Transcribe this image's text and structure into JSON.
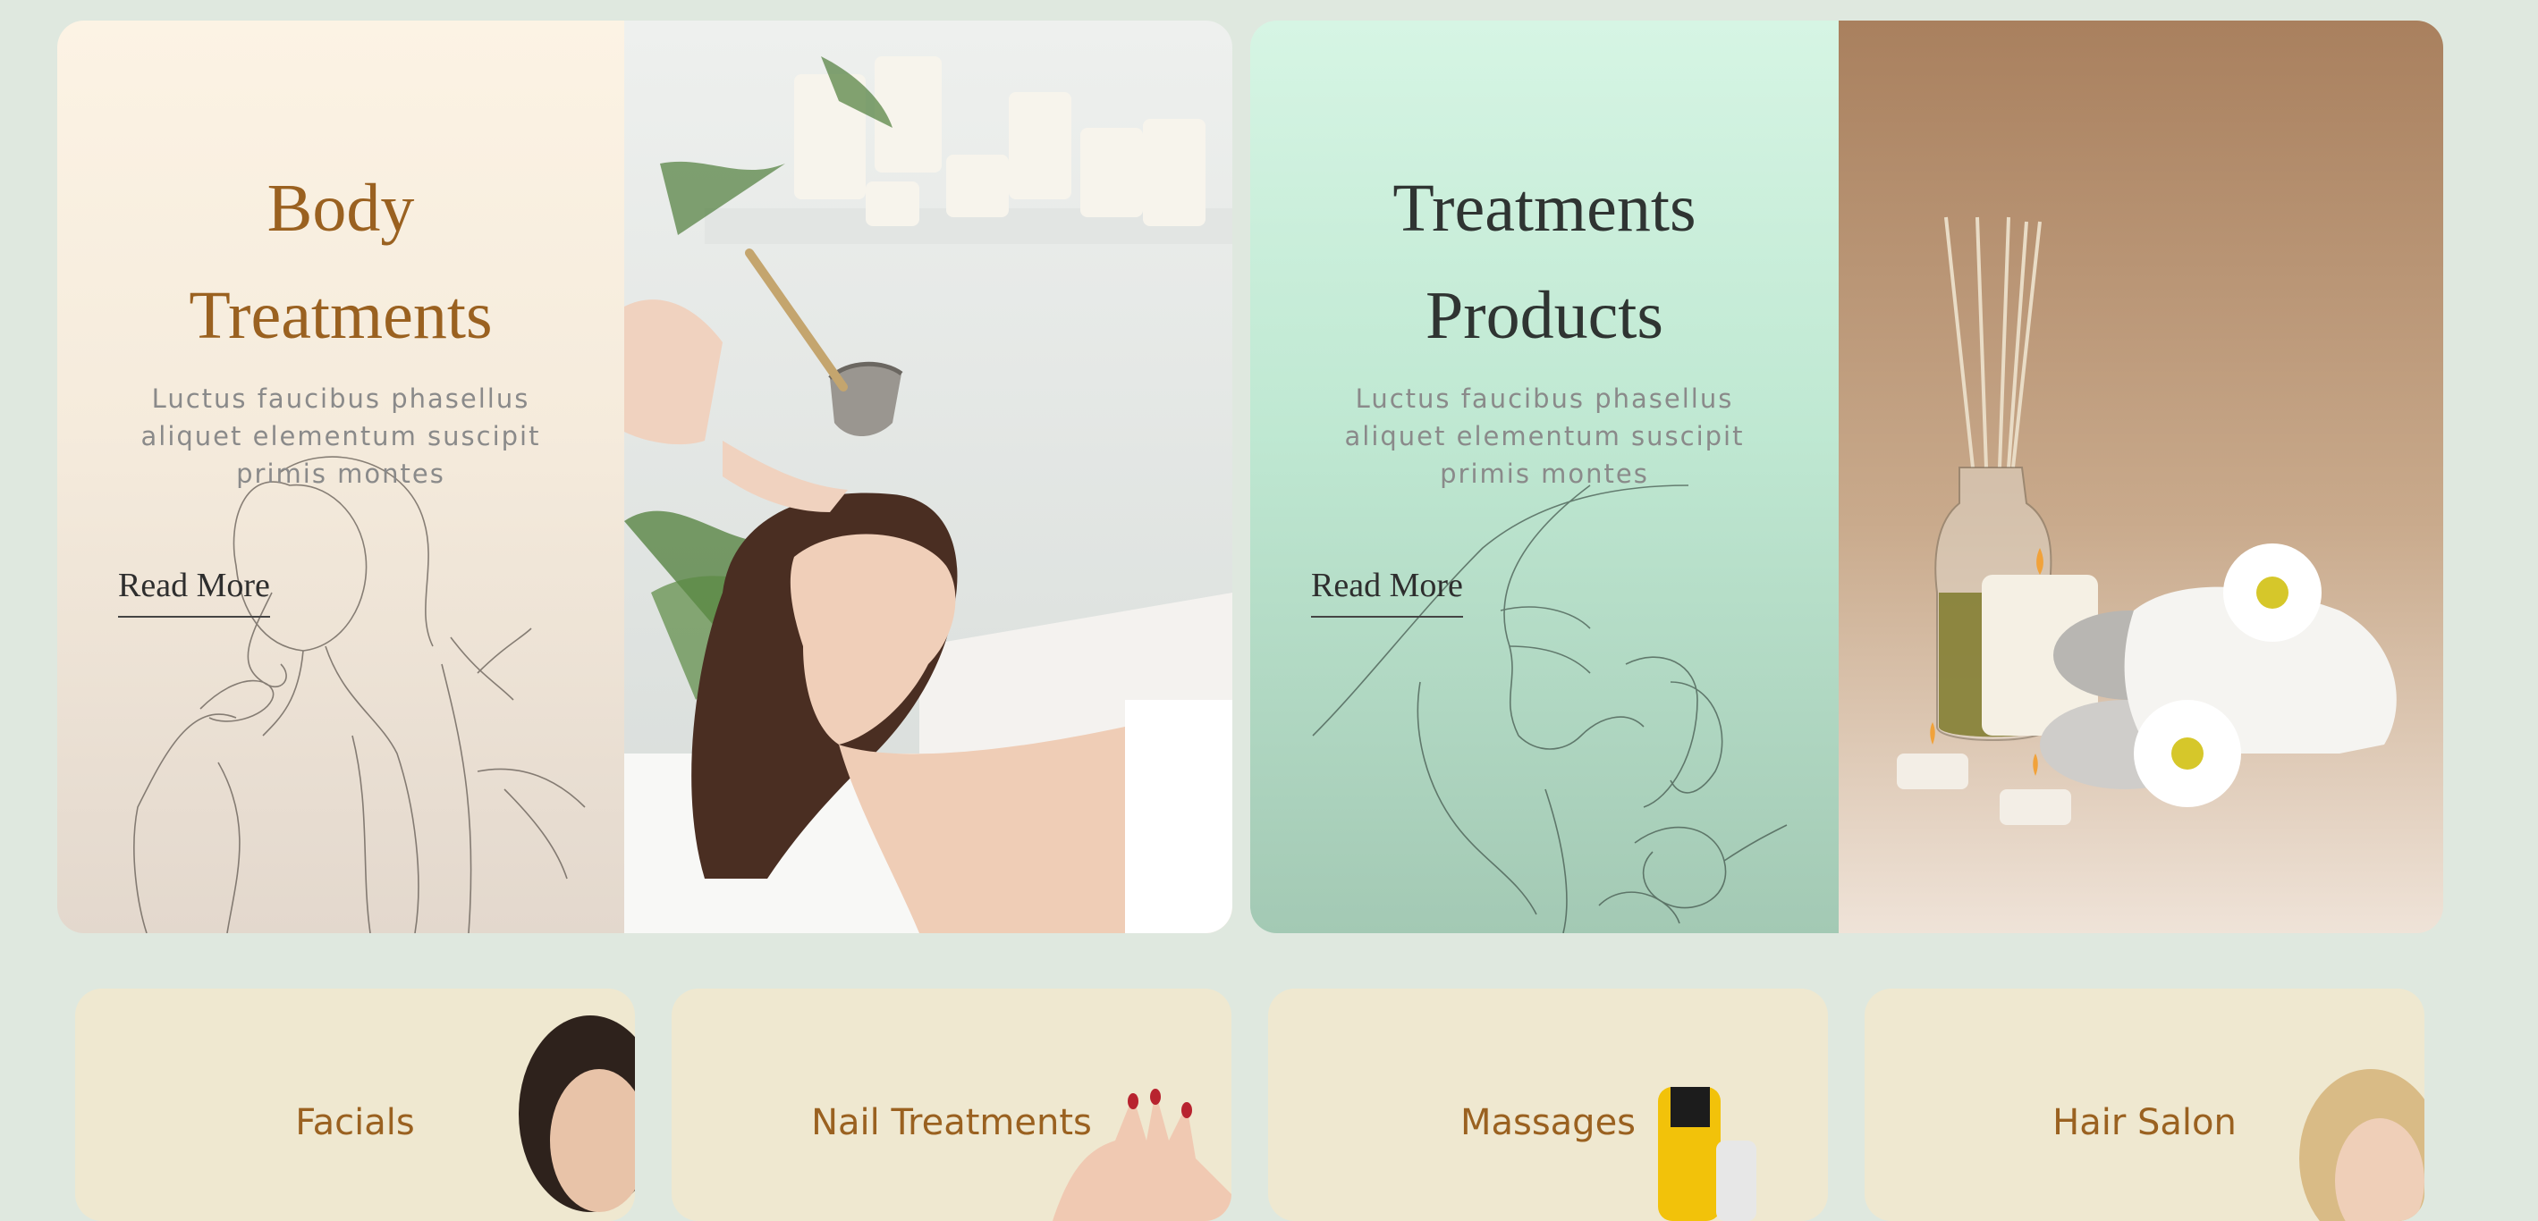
{
  "promos": [
    {
      "title": "Body\nTreatments",
      "description": "Luctus faucibus phasellus aliquet elementum suscipit primis montes",
      "link_label": "Read More",
      "accent": "#9a6120"
    },
    {
      "title": "Treatments\nProducts",
      "description": "Luctus faucibus phasellus aliquet elementum suscipit primis montes",
      "link_label": "Read More",
      "accent": "#2f3432"
    }
  ],
  "categories": [
    {
      "label": "Facials"
    },
    {
      "label": "Nail Treatments"
    },
    {
      "label": "Massages"
    },
    {
      "label": "Hair Salon"
    }
  ],
  "colors": {
    "page_background": "#dfe8df",
    "card_background": "#efe8d0",
    "brand_brown": "#9a6120"
  }
}
